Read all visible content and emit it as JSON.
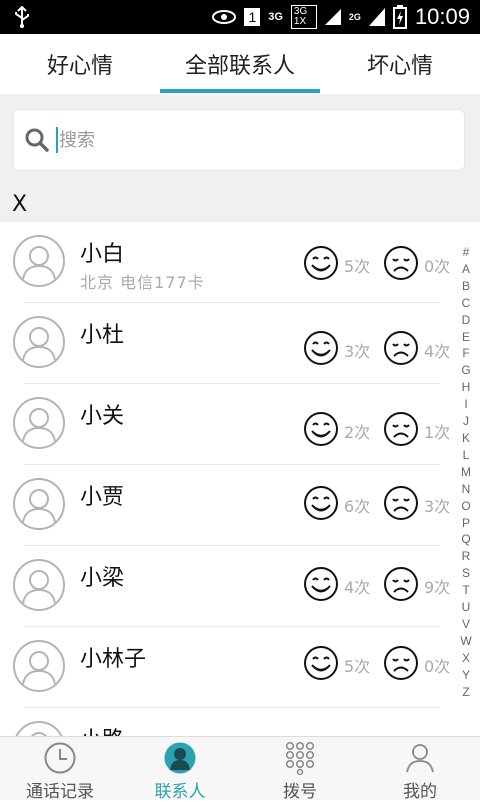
{
  "status_bar": {
    "time": "10:09",
    "network_3g": "3G",
    "network_3g_1x": "3G 1X",
    "network_2g": "2G",
    "sim_slot": "1"
  },
  "tabs": [
    {
      "label": "好心情",
      "active": false
    },
    {
      "label": "全部联系人",
      "active": true
    },
    {
      "label": "坏心情",
      "active": false
    }
  ],
  "search": {
    "placeholder": "搜索",
    "value": ""
  },
  "section": {
    "letter": "X"
  },
  "contacts": [
    {
      "name": "小白",
      "subtitle": "北京   电信177卡",
      "happy": "5次",
      "sad": "0次"
    },
    {
      "name": "小杜",
      "subtitle": "",
      "happy": "3次",
      "sad": "4次"
    },
    {
      "name": "小关",
      "subtitle": "",
      "happy": "2次",
      "sad": "1次"
    },
    {
      "name": "小贾",
      "subtitle": "",
      "happy": "6次",
      "sad": "3次"
    },
    {
      "name": "小梁",
      "subtitle": "",
      "happy": "4次",
      "sad": "9次"
    },
    {
      "name": "小林子",
      "subtitle": "",
      "happy": "5次",
      "sad": "0次"
    },
    {
      "name": "小路",
      "subtitle": "",
      "happy": "",
      "sad": ""
    }
  ],
  "index_letters": [
    "#",
    "A",
    "B",
    "C",
    "D",
    "E",
    "F",
    "G",
    "H",
    "I",
    "J",
    "K",
    "L",
    "M",
    "N",
    "O",
    "P",
    "Q",
    "R",
    "S",
    "T",
    "U",
    "V",
    "W",
    "X",
    "Y",
    "Z"
  ],
  "bottom_nav": [
    {
      "label": "通话记录",
      "icon": "clock-icon",
      "active": false
    },
    {
      "label": "联系人",
      "icon": "person-icon",
      "active": true
    },
    {
      "label": "拨号",
      "icon": "dialpad-icon",
      "active": false
    },
    {
      "label": "我的",
      "icon": "user-outline-icon",
      "active": false
    }
  ],
  "colors": {
    "accent": "#2aa3b0",
    "muted": "#aaaaaa"
  }
}
